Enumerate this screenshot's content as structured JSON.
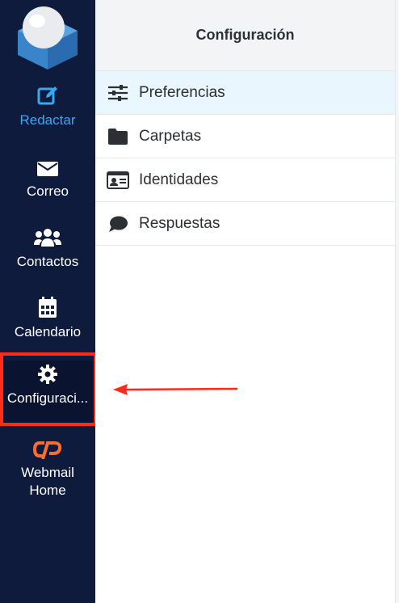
{
  "sidebar": {
    "items": [
      {
        "label": "Redactar",
        "icon": "compose-icon"
      },
      {
        "label": "Correo",
        "icon": "envelope-icon"
      },
      {
        "label": "Contactos",
        "icon": "users-icon"
      },
      {
        "label": "Calendario",
        "icon": "calendar-icon"
      },
      {
        "label": "Configuraci...",
        "icon": "gear-icon"
      },
      {
        "label": "Webmail",
        "label2": "Home",
        "icon": "cpanel-icon"
      }
    ]
  },
  "panel": {
    "title": "Configuración",
    "items": [
      {
        "label": "Preferencias",
        "icon": "sliders-icon"
      },
      {
        "label": "Carpetas",
        "icon": "folder-icon"
      },
      {
        "label": "Identidades",
        "icon": "id-card-icon"
      },
      {
        "label": "Respuestas",
        "icon": "speech-bubble-icon"
      }
    ]
  },
  "colors": {
    "sidebar_bg": "#0f1b3d",
    "accent": "#37a8f2",
    "highlight": "#ff2a17",
    "active_row": "#eaf6fd"
  }
}
